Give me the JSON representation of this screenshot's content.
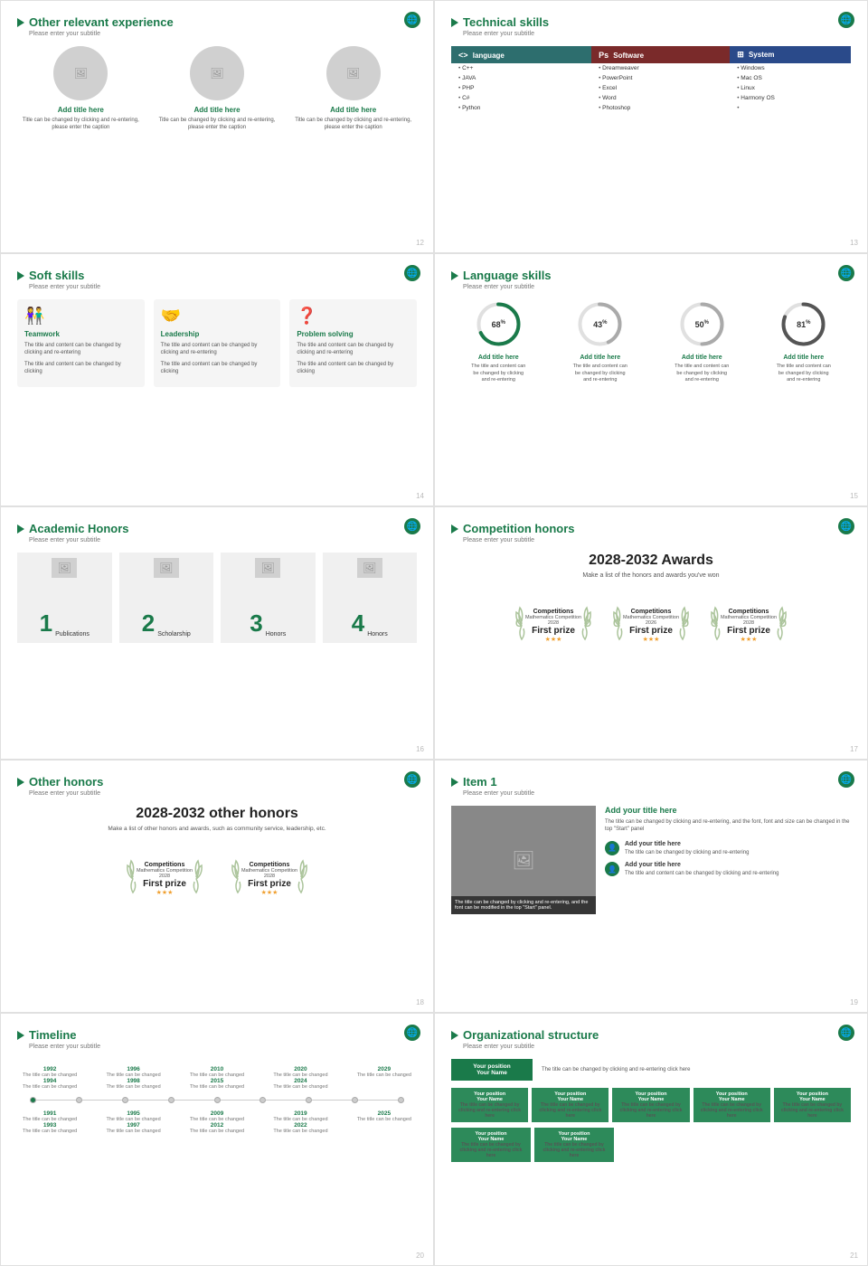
{
  "slides": [
    {
      "id": "other-relevant-exp",
      "title": "Other relevant experience",
      "subtitle": "Please enter your subtitle",
      "num": "12",
      "items": [
        {
          "title": "Add title here",
          "text": "Title can be changed by clicking and re-entering, please enter the caption"
        },
        {
          "title": "Add title here",
          "text": "Title can be changed by clicking and re-entering, please enter the caption"
        },
        {
          "title": "Add title here",
          "text": "Title can be changed by clicking and re-entering, please enter the caption"
        }
      ]
    },
    {
      "id": "technical-skills",
      "title": "Technical skills",
      "subtitle": "Please enter your subtitle",
      "num": "13",
      "cols": [
        {
          "header": "language",
          "items": [
            "C++",
            "JAVA",
            "PHP",
            "C#",
            "Python"
          ]
        },
        {
          "header": "Software",
          "items": [
            "Dreamweaver",
            "PowerPoint",
            "Excel",
            "Word",
            "Photoshop"
          ]
        },
        {
          "header": "System",
          "items": [
            "Windows",
            "Mac OS",
            "Linux",
            "Harmony OS"
          ]
        }
      ]
    },
    {
      "id": "soft-skills",
      "title": "Soft skills",
      "subtitle": "Please enter your subtitle",
      "num": "14",
      "items": [
        {
          "title": "Teamwork",
          "text1": "The title and content can be changed by clicking and re-entering",
          "text2": "The title and content can be changed by clicking"
        },
        {
          "title": "Leadership",
          "text1": "The title and content can be changed by clicking and re-entering",
          "text2": "The title and content can be changed by clicking"
        },
        {
          "title": "Problem solving",
          "text1": "The title and content can be changed by clicking and re-entering",
          "text2": "The title and content can be changed by clicking"
        }
      ]
    },
    {
      "id": "language-skills",
      "title": "Language skills",
      "subtitle": "Please enter your subtitle",
      "num": "15",
      "items": [
        {
          "pct": 68,
          "title": "Add title here",
          "text": "The title and content can be changed by clicking and re-entering"
        },
        {
          "pct": 43,
          "title": "Add title here",
          "text": "The title and content can be changed by clicking and re-entering"
        },
        {
          "pct": 50,
          "title": "Add title here",
          "text": "The title and content can be changed by clicking and re-entering"
        },
        {
          "pct": 81,
          "title": "Add title here",
          "text": "The title and content can be changed by clicking and re-entering"
        }
      ]
    },
    {
      "id": "academic-honors",
      "title": "Academic Honors",
      "subtitle": "Please enter your subtitle",
      "num": "16",
      "labels": [
        "Publications",
        "Scholarship",
        "Honors",
        "Honors"
      ],
      "nums": [
        "1",
        "2",
        "3",
        "4"
      ]
    },
    {
      "id": "competition-honors",
      "title": "Competition honors",
      "subtitle": "Please enter your subtitle",
      "num": "17",
      "award_title": "2028-2032 Awards",
      "award_sub": "Make a list of the honors and awards you've won",
      "badges": [
        {
          "comp": "Competitions",
          "sub": "Mathematics Competition\n2028",
          "prize": "First prize"
        },
        {
          "comp": "Competitions",
          "sub": "Mathematics Competition\n2026",
          "prize": "First prize"
        },
        {
          "comp": "Competitions",
          "sub": "Mathematics Competition\n2028",
          "prize": "First prize"
        }
      ]
    },
    {
      "id": "other-honors",
      "title": "Other honors",
      "subtitle": "Please enter your subtitle",
      "num": "18",
      "award_title": "2028-2032 other honors",
      "award_sub": "Make a list of other honors and awards, such as community service, leadership, etc.",
      "badges": [
        {
          "comp": "Competitions",
          "sub": "Mathematics Competition\n2028",
          "prize": "First prize"
        },
        {
          "comp": "Competitions",
          "sub": "Mathematics Competition\n2028",
          "prize": "First prize"
        }
      ]
    },
    {
      "id": "item1",
      "title": "Item 1",
      "subtitle": "Please enter your subtitle",
      "num": "19",
      "main_title": "Add your title here",
      "main_text": "The title can be changed by clicking and re-entering, and the font, font and size can be changed in the top \"Start\" panel",
      "sub_items": [
        {
          "title": "Add your title here",
          "text": "The title can be changed by clicking and re-entering"
        },
        {
          "title": "Add your title here",
          "text": "The title and content can be changed by clicking and re-entering"
        }
      ],
      "img_caption": "The title can be changed by clicking and re-entering, and the font can be modified in the top \"Start\" panel."
    },
    {
      "id": "timeline",
      "title": "Timeline",
      "subtitle": "Please enter your subtitle",
      "num": "20",
      "top_years": [
        "1992",
        "1996",
        "2010",
        "2020",
        "2029"
      ],
      "bottom_years": [
        "1991",
        "1995",
        "2009",
        "2019",
        "2025"
      ],
      "all_years": [
        "1992",
        "1994",
        "1996",
        "1998",
        "2010",
        "2015",
        "2020",
        "2024",
        "2029"
      ]
    },
    {
      "id": "org-structure",
      "title": "Organizational structure",
      "subtitle": "Please enter your subtitle",
      "num": "21",
      "top": {
        "pos": "Your position",
        "name": "Your Name"
      },
      "row1": [
        {
          "pos": "Your position",
          "name": "Your Name"
        },
        {
          "pos": "Your position",
          "name": "Your Name"
        },
        {
          "pos": "Your position",
          "name": "Your Name"
        },
        {
          "pos": "Your position",
          "name": "Your Name"
        },
        {
          "pos": "Your position",
          "name": "Your Name"
        }
      ],
      "row2": [
        {
          "pos": "Your position",
          "name": "Your Name"
        },
        {
          "pos": "Your position",
          "name": "Your Name"
        }
      ]
    }
  ]
}
